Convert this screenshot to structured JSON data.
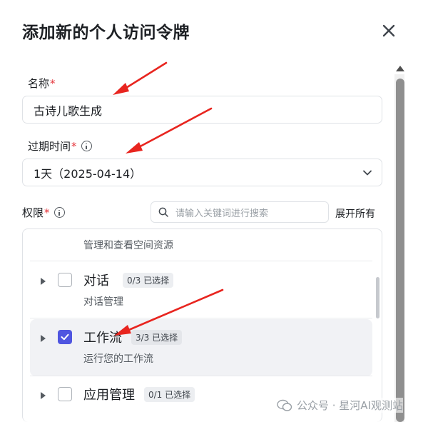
{
  "dialog": {
    "title": "添加新的个人访问令牌",
    "close_icon": "close-icon"
  },
  "name_field": {
    "label": "名称",
    "required_mark": "*",
    "value": "古诗儿歌生成"
  },
  "expiry_field": {
    "label": "过期时间",
    "required_mark": "*",
    "info_icon": "info-icon",
    "value": "1天（2025-04-14）",
    "chevron_icon": "chevron-down-icon"
  },
  "permissions": {
    "label": "权限",
    "required_mark": "*",
    "info_icon": "info-icon",
    "search_placeholder": "请输入关键词进行搜索",
    "expand_all": "展开所有",
    "top_description": "管理和查看空间资源",
    "items": [
      {
        "name": "对话",
        "badge": "0/3 已选择",
        "description": "对话管理",
        "checked": false,
        "highlighted": false
      },
      {
        "name": "工作流",
        "badge": "3/3 已选择",
        "description": "运行您的工作流",
        "checked": true,
        "highlighted": true
      },
      {
        "name": "应用管理",
        "badge": "0/1 已选择",
        "description": "",
        "checked": false,
        "highlighted": false
      }
    ]
  },
  "watermark": {
    "text": "公众号 · 星河AI观测站"
  },
  "colors": {
    "accent": "#4f55e0",
    "required": "#e5353b",
    "annotation_arrow": "#e8251f"
  }
}
